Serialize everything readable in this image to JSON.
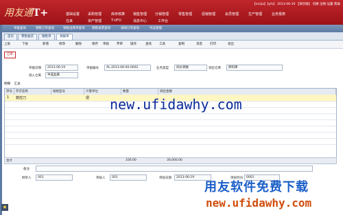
{
  "header": {
    "logo_text": "用友通",
    "logo_mark": "T+",
    "top_info": "【ninjia】【yfs】 2013-06-19 【演示版】",
    "top_actions": [
      "切换",
      "注销",
      "设置",
      "帮助"
    ],
    "nav_row1": [
      "基础设置",
      "采购管理",
      "库存核算",
      "销售管理",
      "分销管理",
      "零售管理",
      "促销管理",
      "会员管理",
      "生产管理",
      "业务报表"
    ],
    "nav_row2": [
      "往来",
      "资产管理",
      "T-UFO",
      "消息中心",
      "工作台"
    ]
  },
  "tabs": [
    "单据查询",
    "销售订单查询",
    "销售出库单查询",
    "销售发票查询",
    "采购订单查询",
    "凭证管理"
  ],
  "doc_tabs": [
    "首页",
    "零售备货",
    "销售单",
    "调拨单"
  ],
  "toolbar": [
    "上张",
    "下张",
    "新增",
    "修改",
    "删除",
    "保存",
    "审核",
    "弃审",
    "操作",
    "查找",
    "工具",
    "复制",
    "消息",
    "打印",
    "退出"
  ],
  "status_badge": "已审",
  "form": {
    "date_label": "单据日期",
    "date_value": "2013-06-19",
    "code_label": "单据编号",
    "code_value": "AL-2013-06-00-0002",
    "type_label": "业务类型",
    "type_value": "同价调拨",
    "out_wh_label": "调出仓库",
    "out_wh_value": "原料库",
    "in_wh_label": "调入仓库",
    "in_wh_value": "半成品库"
  },
  "table_tabs": [
    "明细",
    "汇总"
  ],
  "table": {
    "headers": [
      "序号",
      "存货名称",
      "规格型号",
      "计量单位",
      "数量",
      "调出金额"
    ],
    "rows": [
      {
        "no": "1",
        "name": "数控刀",
        "spec": "",
        "unit": "把",
        "qty": "",
        "amount": ""
      }
    ],
    "sum_label": "合计",
    "sum_qty": "100.00",
    "sum_amount": "30,000.00"
  },
  "footer": {
    "remark_label": "备注",
    "maker_label": "制单人",
    "maker_value": "001",
    "auditor_label": "审核人",
    "auditor_value": "001",
    "audit_date_label": "审核日期",
    "audit_date_value": "2013-06-19",
    "reviewer_label": "审核时间",
    "reviewer_value": "0001"
  },
  "watermarks": {
    "center": "new.ufidawhy.com",
    "cn": "用友软件免费下载",
    "url": "new.ufidawhy.com"
  },
  "colors": {
    "header": "#b81c22",
    "tabbar": "#6a86ae",
    "accent": "#c0262b"
  }
}
